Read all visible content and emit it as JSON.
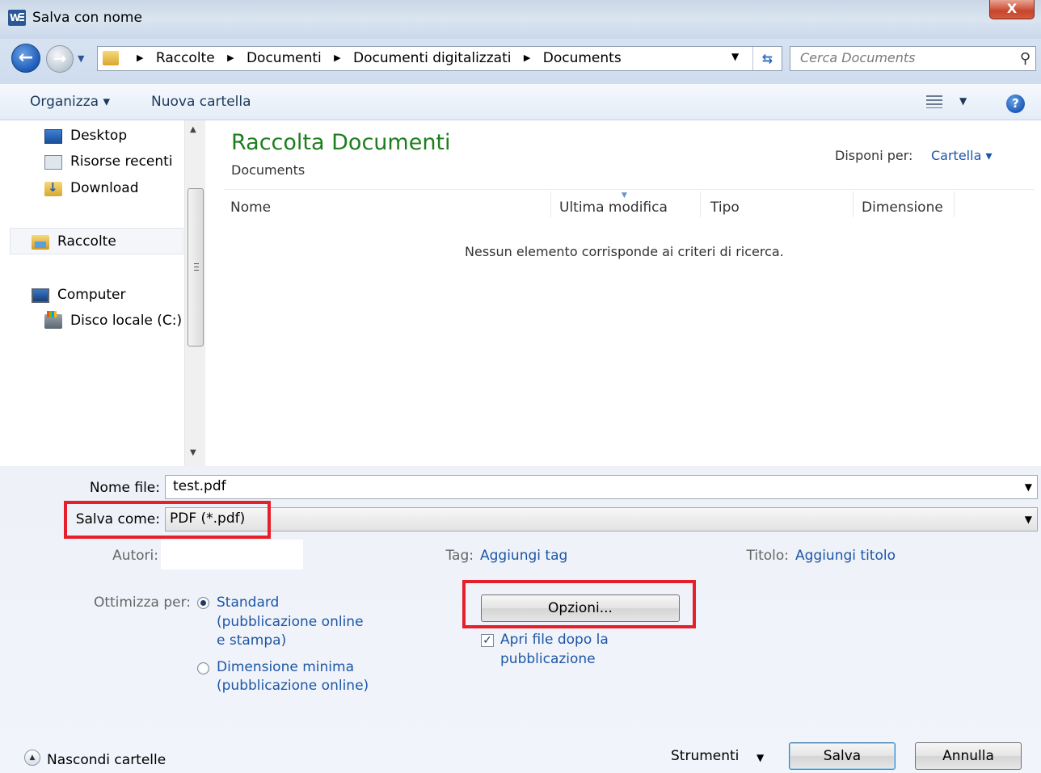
{
  "window": {
    "title": "Salva con nome",
    "app_icon": "word-icon",
    "close_label": "X"
  },
  "address": {
    "crumbs": [
      "Raccolte",
      "Documenti",
      "Documenti digitalizzati",
      "Documents"
    ],
    "separator": "▶",
    "search_placeholder": "Cerca Documents"
  },
  "toolbar": {
    "organize": "Organizza ▾",
    "new_folder": "Nuova cartella",
    "help": "?"
  },
  "nav": {
    "items": [
      {
        "label": "Desktop",
        "icon": "desktop-icon"
      },
      {
        "label": "Risorse recenti",
        "icon": "recent-places-icon"
      },
      {
        "label": "Download",
        "icon": "downloads-folder-icon"
      },
      {
        "label": "Raccolte",
        "icon": "libraries-icon"
      },
      {
        "label": "Computer",
        "icon": "computer-icon"
      },
      {
        "label": "Disco locale (C:)",
        "icon": "local-disk-icon"
      }
    ]
  },
  "content": {
    "library_title": "Raccolta Documenti",
    "library_subtitle": "Documents",
    "arrange_label": "Disponi per:",
    "arrange_value": "Cartella ▾",
    "columns": [
      "Nome",
      "Ultima modifica",
      "Tipo",
      "Dimensione"
    ],
    "empty_message": "Nessun elemento corrisponde ai criteri di ricerca."
  },
  "form": {
    "filename_label": "Nome file:",
    "filename_value": "test.pdf",
    "saveas_label": "Salva come:",
    "saveas_value": "PDF (*.pdf)",
    "authors_label": "Autori:",
    "tags_label": "Tag:",
    "tags_link": "Aggiungi tag",
    "title_label": "Titolo:",
    "title_link": "Aggiungi titolo",
    "optimize_label": "Ottimizza per:",
    "option_standard": [
      "Standard",
      "(pubblicazione online",
      "e stampa)"
    ],
    "option_minimum": [
      "Dimensione minima",
      "(pubblicazione online)"
    ],
    "options_button": "Opzioni...",
    "open_after": [
      "Apri file dopo la",
      "pubblicazione"
    ],
    "hide_folders": "Nascondi cartelle",
    "tools": "Strumenti",
    "save_button": "Salva",
    "cancel_button": "Annulla"
  },
  "colors": {
    "highlight_box": "#e5202a",
    "link": "#1e56a6",
    "library_title": "#1e7d1e"
  }
}
